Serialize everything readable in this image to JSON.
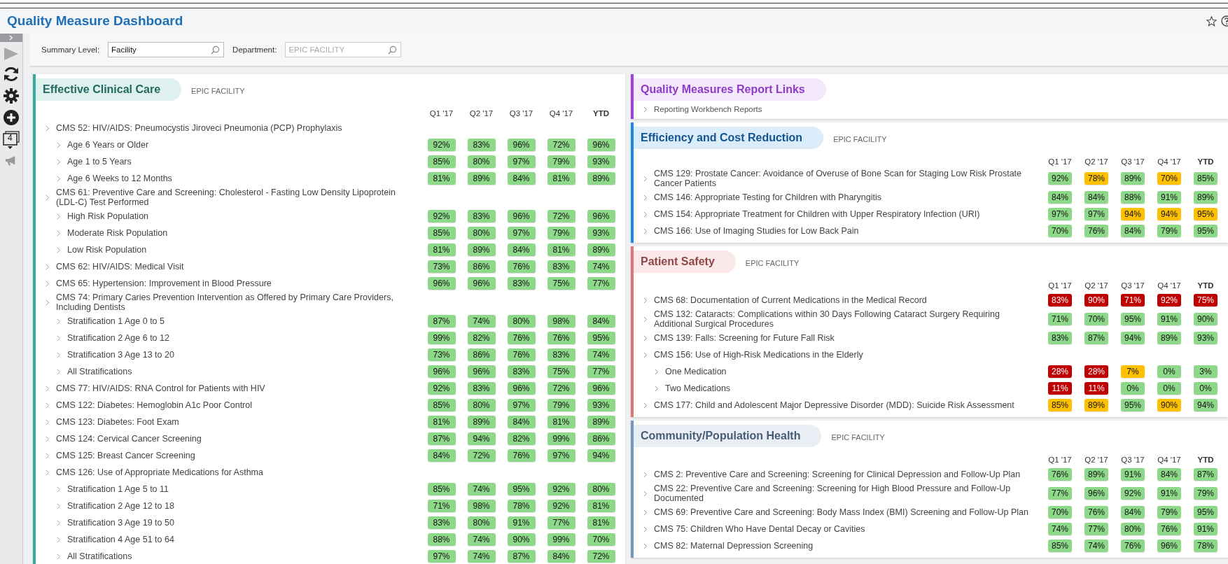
{
  "window": {
    "title": "Quality Measure Dashboard"
  },
  "toolbar": {
    "monitor_count": "4"
  },
  "filters": [
    {
      "label": "Summary Level:",
      "value": "Facility",
      "disabled": false
    },
    {
      "label": "Department:",
      "placeholder": "EPIC FACILITY",
      "disabled": true
    }
  ],
  "clinical_care": {
    "title": "Effective Clinical Care",
    "subtitle": "EPIC FACILITY",
    "color": "#3aaa9d",
    "columns": [
      "Q1 '17",
      "Q2 '17",
      "Q3 '17",
      "Q4 '17",
      "YTD"
    ],
    "rows": [
      {
        "label": "CMS 52: HIV/AIDS: Pneumocystis Jiroveci Pneumonia (PCP) Prophylaxis",
        "children": [
          {
            "label": "Age 6 Years or Older",
            "values": [
              {
                "text": "92%",
                "color": "#8ed88a"
              },
              {
                "text": "83%",
                "color": "#8ed88a"
              },
              {
                "text": "96%",
                "color": "#8ed88a"
              },
              {
                "text": "72%",
                "color": "#8ed88a"
              },
              {
                "text": "96%",
                "color": "#8ed88a"
              }
            ]
          },
          {
            "label": "Age 1 to 5 Years",
            "values": [
              {
                "text": "85%",
                "color": "#8ed88a"
              },
              {
                "text": "80%",
                "color": "#8ed88a"
              },
              {
                "text": "97%",
                "color": "#8ed88a"
              },
              {
                "text": "79%",
                "color": "#8ed88a"
              },
              {
                "text": "93%",
                "color": "#8ed88a"
              }
            ]
          },
          {
            "label": "Age 6 Weeks to 12 Months",
            "values": [
              {
                "text": "81%",
                "color": "#8ed88a"
              },
              {
                "text": "89%",
                "color": "#8ed88a"
              },
              {
                "text": "84%",
                "color": "#8ed88a"
              },
              {
                "text": "81%",
                "color": "#8ed88a"
              },
              {
                "text": "89%",
                "color": "#8ed88a"
              }
            ]
          }
        ]
      },
      {
        "label": "CMS 61: Preventive Care and Screening: Cholesterol - Fasting Low Density Lipoprotein (LDL-C) Test Performed",
        "children": [
          {
            "label": "High Risk Population",
            "values": [
              {
                "text": "92%",
                "color": "#8ed88a"
              },
              {
                "text": "83%",
                "color": "#8ed88a"
              },
              {
                "text": "96%",
                "color": "#8ed88a"
              },
              {
                "text": "72%",
                "color": "#8ed88a"
              },
              {
                "text": "96%",
                "color": "#8ed88a"
              }
            ]
          },
          {
            "label": "Moderate Risk Population",
            "values": [
              {
                "text": "85%",
                "color": "#8ed88a"
              },
              {
                "text": "80%",
                "color": "#8ed88a"
              },
              {
                "text": "97%",
                "color": "#8ed88a"
              },
              {
                "text": "79%",
                "color": "#8ed88a"
              },
              {
                "text": "93%",
                "color": "#8ed88a"
              }
            ]
          },
          {
            "label": "Low Risk Population",
            "values": [
              {
                "text": "81%",
                "color": "#8ed88a"
              },
              {
                "text": "89%",
                "color": "#8ed88a"
              },
              {
                "text": "84%",
                "color": "#8ed88a"
              },
              {
                "text": "81%",
                "color": "#8ed88a"
              },
              {
                "text": "89%",
                "color": "#8ed88a"
              }
            ]
          }
        ]
      },
      {
        "label": "CMS 62: HIV/AIDS: Medical Visit",
        "values": [
          {
            "text": "73%",
            "color": "#8ed88a"
          },
          {
            "text": "86%",
            "color": "#8ed88a"
          },
          {
            "text": "76%",
            "color": "#8ed88a"
          },
          {
            "text": "83%",
            "color": "#8ed88a"
          },
          {
            "text": "74%",
            "color": "#8ed88a"
          }
        ]
      },
      {
        "label": "CMS 65: Hypertension: Improvement in Blood Pressure",
        "values": [
          {
            "text": "96%",
            "color": "#8ed88a"
          },
          {
            "text": "96%",
            "color": "#8ed88a"
          },
          {
            "text": "83%",
            "color": "#8ed88a"
          },
          {
            "text": "75%",
            "color": "#8ed88a"
          },
          {
            "text": "77%",
            "color": "#8ed88a"
          }
        ]
      },
      {
        "label": "CMS 74: Primary Caries Prevention Intervention as Offered by Primary Care Providers, Including Dentists",
        "children": [
          {
            "label": "Stratification 1 Age 0 to 5",
            "values": [
              {
                "text": "87%",
                "color": "#8ed88a"
              },
              {
                "text": "74%",
                "color": "#8ed88a"
              },
              {
                "text": "80%",
                "color": "#8ed88a"
              },
              {
                "text": "98%",
                "color": "#8ed88a"
              },
              {
                "text": "84%",
                "color": "#8ed88a"
              }
            ]
          },
          {
            "label": "Stratification 2 Age 6 to 12",
            "values": [
              {
                "text": "99%",
                "color": "#8ed88a"
              },
              {
                "text": "82%",
                "color": "#8ed88a"
              },
              {
                "text": "76%",
                "color": "#8ed88a"
              },
              {
                "text": "76%",
                "color": "#8ed88a"
              },
              {
                "text": "95%",
                "color": "#8ed88a"
              }
            ]
          },
          {
            "label": "Stratification 3 Age 13 to 20",
            "values": [
              {
                "text": "73%",
                "color": "#8ed88a"
              },
              {
                "text": "86%",
                "color": "#8ed88a"
              },
              {
                "text": "76%",
                "color": "#8ed88a"
              },
              {
                "text": "83%",
                "color": "#8ed88a"
              },
              {
                "text": "74%",
                "color": "#8ed88a"
              }
            ]
          },
          {
            "label": "All Stratifications",
            "values": [
              {
                "text": "96%",
                "color": "#8ed88a"
              },
              {
                "text": "96%",
                "color": "#8ed88a"
              },
              {
                "text": "83%",
                "color": "#8ed88a"
              },
              {
                "text": "75%",
                "color": "#8ed88a"
              },
              {
                "text": "77%",
                "color": "#8ed88a"
              }
            ]
          }
        ]
      },
      {
        "label": "CMS 77: HIV/AIDS: RNA Control for Patients with HIV",
        "values": [
          {
            "text": "92%",
            "color": "#8ed88a"
          },
          {
            "text": "83%",
            "color": "#8ed88a"
          },
          {
            "text": "96%",
            "color": "#8ed88a"
          },
          {
            "text": "72%",
            "color": "#8ed88a"
          },
          {
            "text": "96%",
            "color": "#8ed88a"
          }
        ]
      },
      {
        "label": "CMS 122: Diabetes: Hemoglobin A1c Poor Control",
        "values": [
          {
            "text": "85%",
            "color": "#8ed88a"
          },
          {
            "text": "80%",
            "color": "#8ed88a"
          },
          {
            "text": "97%",
            "color": "#8ed88a"
          },
          {
            "text": "79%",
            "color": "#8ed88a"
          },
          {
            "text": "93%",
            "color": "#8ed88a"
          }
        ]
      },
      {
        "label": "CMS 123: Diabetes: Foot Exam",
        "values": [
          {
            "text": "81%",
            "color": "#8ed88a"
          },
          {
            "text": "89%",
            "color": "#8ed88a"
          },
          {
            "text": "84%",
            "color": "#8ed88a"
          },
          {
            "text": "81%",
            "color": "#8ed88a"
          },
          {
            "text": "89%",
            "color": "#8ed88a"
          }
        ]
      },
      {
        "label": "CMS 124: Cervical Cancer Screening",
        "values": [
          {
            "text": "87%",
            "color": "#8ed88a"
          },
          {
            "text": "94%",
            "color": "#8ed88a"
          },
          {
            "text": "82%",
            "color": "#8ed88a"
          },
          {
            "text": "99%",
            "color": "#8ed88a"
          },
          {
            "text": "86%",
            "color": "#8ed88a"
          }
        ]
      },
      {
        "label": "CMS 125: Breast Cancer Screening",
        "values": [
          {
            "text": "84%",
            "color": "#8ed88a"
          },
          {
            "text": "72%",
            "color": "#8ed88a"
          },
          {
            "text": "76%",
            "color": "#8ed88a"
          },
          {
            "text": "97%",
            "color": "#8ed88a"
          },
          {
            "text": "94%",
            "color": "#8ed88a"
          }
        ]
      },
      {
        "label": "CMS 126: Use of Appropriate Medications for Asthma",
        "children": [
          {
            "label": "Stratification 1 Age 5 to 11",
            "values": [
              {
                "text": "85%",
                "color": "#8ed88a"
              },
              {
                "text": "74%",
                "color": "#8ed88a"
              },
              {
                "text": "95%",
                "color": "#8ed88a"
              },
              {
                "text": "92%",
                "color": "#8ed88a"
              },
              {
                "text": "80%",
                "color": "#8ed88a"
              }
            ]
          },
          {
            "label": "Stratification 2 Age 12 to 18",
            "values": [
              {
                "text": "71%",
                "color": "#8ed88a"
              },
              {
                "text": "98%",
                "color": "#8ed88a"
              },
              {
                "text": "78%",
                "color": "#8ed88a"
              },
              {
                "text": "92%",
                "color": "#8ed88a"
              },
              {
                "text": "81%",
                "color": "#8ed88a"
              }
            ]
          },
          {
            "label": "Stratification 3 Age 19 to 50",
            "values": [
              {
                "text": "83%",
                "color": "#8ed88a"
              },
              {
                "text": "80%",
                "color": "#8ed88a"
              },
              {
                "text": "91%",
                "color": "#8ed88a"
              },
              {
                "text": "77%",
                "color": "#8ed88a"
              },
              {
                "text": "81%",
                "color": "#8ed88a"
              }
            ]
          },
          {
            "label": "Stratification 4 Age 51 to 64",
            "values": [
              {
                "text": "88%",
                "color": "#8ed88a"
              },
              {
                "text": "74%",
                "color": "#8ed88a"
              },
              {
                "text": "90%",
                "color": "#8ed88a"
              },
              {
                "text": "99%",
                "color": "#8ed88a"
              },
              {
                "text": "70%",
                "color": "#8ed88a"
              }
            ]
          },
          {
            "label": "All Stratifications",
            "values": [
              {
                "text": "97%",
                "color": "#8ed88a"
              },
              {
                "text": "74%",
                "color": "#8ed88a"
              },
              {
                "text": "87%",
                "color": "#8ed88a"
              },
              {
                "text": "84%",
                "color": "#8ed88a"
              },
              {
                "text": "72%",
                "color": "#8ed88a"
              }
            ]
          }
        ]
      }
    ]
  },
  "report_links": {
    "title": "Quality Measures Report Links",
    "color": "#a040e0",
    "links": [
      "Reporting Workbench Reports"
    ]
  },
  "right_sections": [
    {
      "title": "Efficiency and Cost Reduction",
      "subtitle": "EPIC FACILITY",
      "color": "#1e88e5",
      "columns": [
        "Q1 '17",
        "Q2 '17",
        "Q3 '17",
        "Q4 '17",
        "YTD"
      ],
      "rows": [
        {
          "label": "CMS 129: Prostate Cancer: Avoidance of Overuse of Bone Scan for Staging Low Risk Prostate Cancer Patients",
          "values": [
            {
              "text": "92%",
              "color": "#8ed88a"
            },
            {
              "text": "78%",
              "color": "#ffc000"
            },
            {
              "text": "89%",
              "color": "#8ed88a"
            },
            {
              "text": "70%",
              "color": "#ffc000"
            },
            {
              "text": "85%",
              "color": "#8ed88a"
            }
          ]
        },
        {
          "label": "CMS 146: Appropriate Testing for Children with Pharyngitis",
          "values": [
            {
              "text": "84%",
              "color": "#8ed88a"
            },
            {
              "text": "84%",
              "color": "#8ed88a"
            },
            {
              "text": "88%",
              "color": "#8ed88a"
            },
            {
              "text": "91%",
              "color": "#8ed88a"
            },
            {
              "text": "89%",
              "color": "#8ed88a"
            }
          ]
        },
        {
          "label": "CMS 154: Appropriate Treatment for Children with Upper Respiratory Infection (URI)",
          "values": [
            {
              "text": "97%",
              "color": "#8ed88a"
            },
            {
              "text": "97%",
              "color": "#8ed88a"
            },
            {
              "text": "94%",
              "color": "#ffc000"
            },
            {
              "text": "94%",
              "color": "#ffc000"
            },
            {
              "text": "95%",
              "color": "#ffc000"
            }
          ]
        },
        {
          "label": "CMS 166: Use of Imaging Studies for Low Back Pain",
          "values": [
            {
              "text": "70%",
              "color": "#8ed88a"
            },
            {
              "text": "76%",
              "color": "#8ed88a"
            },
            {
              "text": "84%",
              "color": "#8ed88a"
            },
            {
              "text": "79%",
              "color": "#8ed88a"
            },
            {
              "text": "95%",
              "color": "#8ed88a"
            }
          ]
        }
      ]
    },
    {
      "title": "Patient Safety",
      "subtitle": "EPIC FACILITY",
      "color": "#e57373",
      "columns": [
        "Q1 '17",
        "Q2 '17",
        "Q3 '17",
        "Q4 '17",
        "YTD"
      ],
      "rows": [
        {
          "label": "CMS 68: Documentation of Current Medications in the Medical Record",
          "values": [
            {
              "text": "83%",
              "color": "#c00000"
            },
            {
              "text": "90%",
              "color": "#c00000"
            },
            {
              "text": "71%",
              "color": "#c00000"
            },
            {
              "text": "92%",
              "color": "#c00000"
            },
            {
              "text": "75%",
              "color": "#c00000"
            }
          ]
        },
        {
          "label": "CMS 132: Cataracts: Complications within 30 Days Following Cataract Surgery Requiring Additional Surgical Procedures",
          "values": [
            {
              "text": "71%",
              "color": "#8ed88a"
            },
            {
              "text": "70%",
              "color": "#8ed88a"
            },
            {
              "text": "95%",
              "color": "#8ed88a"
            },
            {
              "text": "91%",
              "color": "#8ed88a"
            },
            {
              "text": "90%",
              "color": "#8ed88a"
            }
          ]
        },
        {
          "label": "CMS 139: Falls: Screening for Future Fall Risk",
          "values": [
            {
              "text": "83%",
              "color": "#8ed88a"
            },
            {
              "text": "87%",
              "color": "#8ed88a"
            },
            {
              "text": "94%",
              "color": "#8ed88a"
            },
            {
              "text": "89%",
              "color": "#8ed88a"
            },
            {
              "text": "93%",
              "color": "#8ed88a"
            }
          ]
        },
        {
          "label": "CMS 156: Use of High-Risk Medications in the Elderly",
          "children": [
            {
              "label": "One Medication",
              "values": [
                {
                  "text": "28%",
                  "color": "#c00000"
                },
                {
                  "text": "28%",
                  "color": "#c00000"
                },
                {
                  "text": "7%",
                  "color": "#ffc000"
                },
                {
                  "text": "0%",
                  "color": "#8ed88a"
                },
                {
                  "text": "3%",
                  "color": "#8ed88a"
                }
              ]
            },
            {
              "label": "Two Medications",
              "values": [
                {
                  "text": "11%",
                  "color": "#c00000"
                },
                {
                  "text": "11%",
                  "color": "#c00000"
                },
                {
                  "text": "0%",
                  "color": "#8ed88a"
                },
                {
                  "text": "0%",
                  "color": "#8ed88a"
                },
                {
                  "text": "0%",
                  "color": "#8ed88a"
                }
              ]
            }
          ]
        },
        {
          "label": "CMS 177: Child and Adolescent Major Depressive Disorder (MDD): Suicide Risk Assessment",
          "values": [
            {
              "text": "85%",
              "color": "#ffc000"
            },
            {
              "text": "89%",
              "color": "#ffc000"
            },
            {
              "text": "95%",
              "color": "#8ed88a"
            },
            {
              "text": "90%",
              "color": "#ffc000"
            },
            {
              "text": "94%",
              "color": "#8ed88a"
            }
          ]
        }
      ]
    },
    {
      "title": "Community/Population Health",
      "subtitle": "EPIC FACILITY",
      "color": "#7396bd",
      "columns": [
        "Q1 '17",
        "Q2 '17",
        "Q3 '17",
        "Q4 '17",
        "YTD"
      ],
      "rows": [
        {
          "label": "CMS 2: Preventive Care and Screening: Screening for Clinical Depression and Follow-Up Plan",
          "values": [
            {
              "text": "76%",
              "color": "#8ed88a"
            },
            {
              "text": "89%",
              "color": "#8ed88a"
            },
            {
              "text": "91%",
              "color": "#8ed88a"
            },
            {
              "text": "84%",
              "color": "#8ed88a"
            },
            {
              "text": "87%",
              "color": "#8ed88a"
            }
          ]
        },
        {
          "label": "CMS 22: Preventive Care and Screening: Screening for High Blood Pressure and Follow-Up Documented",
          "values": [
            {
              "text": "77%",
              "color": "#8ed88a"
            },
            {
              "text": "96%",
              "color": "#8ed88a"
            },
            {
              "text": "92%",
              "color": "#8ed88a"
            },
            {
              "text": "91%",
              "color": "#8ed88a"
            },
            {
              "text": "79%",
              "color": "#8ed88a"
            }
          ]
        },
        {
          "label": "CMS 69: Preventive Care and Screening: Body Mass Index (BMI) Screening and Follow-Up Plan",
          "values": [
            {
              "text": "70%",
              "color": "#8ed88a"
            },
            {
              "text": "76%",
              "color": "#8ed88a"
            },
            {
              "text": "84%",
              "color": "#8ed88a"
            },
            {
              "text": "79%",
              "color": "#8ed88a"
            },
            {
              "text": "95%",
              "color": "#8ed88a"
            }
          ]
        },
        {
          "label": "CMS 75: Children Who Have Dental Decay or Cavities",
          "values": [
            {
              "text": "74%",
              "color": "#8ed88a"
            },
            {
              "text": "77%",
              "color": "#8ed88a"
            },
            {
              "text": "80%",
              "color": "#8ed88a"
            },
            {
              "text": "76%",
              "color": "#8ed88a"
            },
            {
              "text": "91%",
              "color": "#8ed88a"
            }
          ]
        },
        {
          "label": "CMS 82: Maternal Depression Screening",
          "values": [
            {
              "text": "85%",
              "color": "#8ed88a"
            },
            {
              "text": "74%",
              "color": "#8ed88a"
            },
            {
              "text": "76%",
              "color": "#8ed88a"
            },
            {
              "text": "96%",
              "color": "#8ed88a"
            },
            {
              "text": "78%",
              "color": "#8ed88a"
            }
          ]
        }
      ]
    }
  ]
}
